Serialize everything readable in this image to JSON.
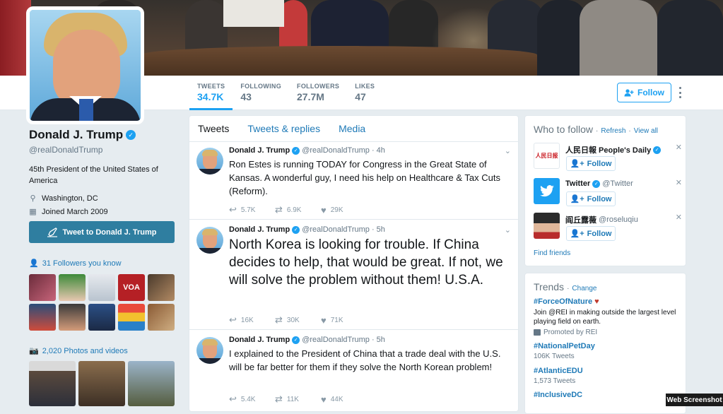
{
  "header": {
    "stats": [
      {
        "label": "TWEETS",
        "value": "34.7K"
      },
      {
        "label": "FOLLOWING",
        "value": "43"
      },
      {
        "label": "FOLLOWERS",
        "value": "27.7M"
      },
      {
        "label": "LIKES",
        "value": "47"
      }
    ],
    "follow_label": "Follow"
  },
  "profile": {
    "name": "Donald J. Trump",
    "handle": "@realDonaldTrump",
    "bio": "45th President of the United States of America",
    "location": "Washington, DC",
    "joined": "Joined March 2009",
    "tweet_to_label": "Tweet to Donald J. Trump",
    "followers_you_know": "31 Followers you know",
    "photos_videos": "2,020 Photos and videos"
  },
  "timeline": {
    "tabs": [
      "Tweets",
      "Tweets & replies",
      "Media"
    ],
    "tweets": [
      {
        "name": "Donald J. Trump",
        "handle": "@realDonaldTrump",
        "time": "4h",
        "text": "Ron Estes is running TODAY for Congress in the Great State of Kansas. A wonderful guy, I need his help on Healthcare & Tax Cuts (Reform).",
        "replies": "5.7K",
        "retweets": "6.9K",
        "likes": "29K"
      },
      {
        "name": "Donald J. Trump",
        "handle": "@realDonaldTrump",
        "time": "5h",
        "text": "North Korea is looking for trouble. If China decides to help, that would be great. If not, we will solve the problem without them!  U.S.A.",
        "replies": "16K",
        "retweets": "30K",
        "likes": "71K"
      },
      {
        "name": "Donald J. Trump",
        "handle": "@realDonaldTrump",
        "time": "5h",
        "text": "I explained to the President of China that a trade deal with the U.S. will be far better for them if they solve the North Korean problem!",
        "replies": "5.4K",
        "retweets": "11K",
        "likes": "44K"
      }
    ]
  },
  "who_to_follow": {
    "title": "Who to follow",
    "refresh": "Refresh",
    "view_all": "View all",
    "sep": "·",
    "follow_label": "Follow",
    "suggestions": [
      {
        "name": "人民日報 People's Daily",
        "handle": "",
        "logo_text": "人民日报"
      },
      {
        "name": "Twitter",
        "handle": "@Twitter"
      },
      {
        "name": "阎丘露薇",
        "handle": "@roseluqiu"
      }
    ],
    "find_friends": "Find friends"
  },
  "trends": {
    "title": "Trends",
    "sep": "·",
    "change": "Change",
    "items": [
      {
        "tag": "#ForceOfNature",
        "desc": "Join @REI in making outside the largest level playing field on earth.",
        "promo": "Promoted by REI"
      },
      {
        "tag": "#NationalPetDay",
        "count": "106K Tweets"
      },
      {
        "tag": "#AtlanticEDU",
        "count": "1,573 Tweets"
      },
      {
        "tag": "#InclusiveDC"
      }
    ]
  },
  "watermark": "Web Screenshot",
  "icons": {
    "reply": "reply-icon",
    "retweet": "retweet-icon",
    "like": "heart-icon",
    "location": "location-pin-icon",
    "calendar": "calendar-icon"
  },
  "colors": {
    "accent": "#1da1f2",
    "link": "#1f7ab7",
    "tweet_to_bg": "#2f7ea0"
  }
}
